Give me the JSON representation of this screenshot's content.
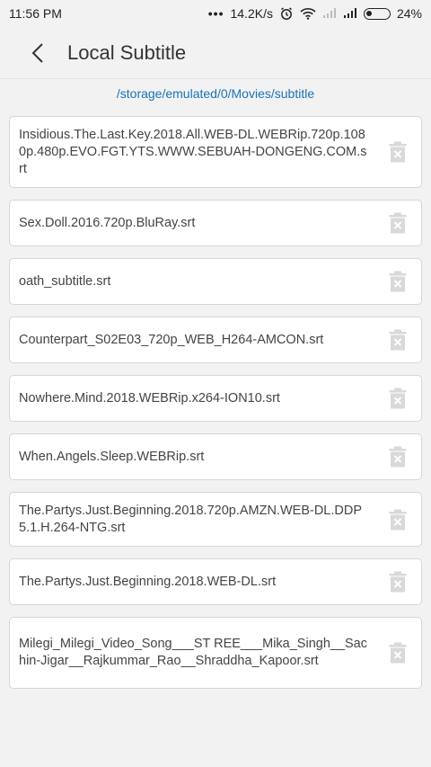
{
  "status_bar": {
    "time": "11:56 PM",
    "more": "•••",
    "net_speed": "14.2K/s",
    "battery_pct": "24%",
    "battery_level": 0.24
  },
  "header": {
    "title": "Local Subtitle",
    "back_icon": "chevron-left-icon"
  },
  "path": "/storage/emulated/0/Movies/subtitle",
  "files": [
    {
      "name": "Insidious.The.Last.Key.2018.All.WEB-DL.WEBRip.720p.1080p.480p.EVO.FGT.YTS.WWW.SEBUAH-DONGENG.COM.srt"
    },
    {
      "name": "Sex.Doll.2016.720p.BluRay.srt"
    },
    {
      "name": "oath_subtitle.srt"
    },
    {
      "name": "Counterpart_S02E03_720p_WEB_H264-AMCON.srt"
    },
    {
      "name": "Nowhere.Mind.2018.WEBRip.x264-ION10.srt"
    },
    {
      "name": "When.Angels.Sleep.WEBRip.srt"
    },
    {
      "name": "The.Partys.Just.Beginning.2018.720p.AMZN.WEB-DL.DDP5.1.H.264-NTG.srt"
    },
    {
      "name": "The.Partys.Just.Beginning.2018.WEB-DL.srt"
    },
    {
      "name": "Milegi_Milegi_Video_Song___ST REE___Mika_Singh__Sachin-Jigar__Rajkummar_Rao__Shraddha_Kapoor.srt"
    }
  ],
  "colors": {
    "accent": "#1a73b5",
    "background": "#f2f2f2",
    "card": "#ffffff",
    "card_border": "#d6d6d6",
    "trash_icon": "#d9d9d9"
  },
  "icons": {
    "delete": "trash-icon",
    "alarm": "alarm-icon",
    "wifi": "wifi-icon",
    "signal": "signal-icon",
    "battery": "battery-icon"
  }
}
